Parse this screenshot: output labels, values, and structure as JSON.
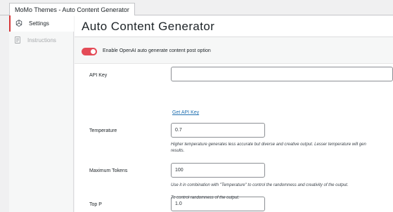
{
  "tab": {
    "label": "MoMo Themes - Auto Content Generator"
  },
  "sidebar": {
    "items": [
      {
        "label": "Settings",
        "icon": "openai-icon"
      },
      {
        "label": "Instructions",
        "icon": "document-icon"
      }
    ]
  },
  "page": {
    "title": "Auto Content Generator"
  },
  "toggle": {
    "label": "Enable OpenAI auto generate content post option",
    "on": true,
    "color": "#e44b57"
  },
  "form": {
    "api_key": {
      "label": "API Key",
      "value": "",
      "link": "Get API Key"
    },
    "temperature": {
      "label": "Temperature",
      "value": "0.7",
      "help_line1": "Higher temperature generates less accurate but diverse and creative output. Lesser temperature will gen",
      "help_line2": "results."
    },
    "max_tokens": {
      "label": "Maximum Tokens",
      "value": "100",
      "help": "Use it in combination with \"Temperature\" to control the randomness and creativity of the output."
    },
    "top_p": {
      "label": "Top P",
      "value": "1.0",
      "help": "To control randomness of the output."
    }
  }
}
